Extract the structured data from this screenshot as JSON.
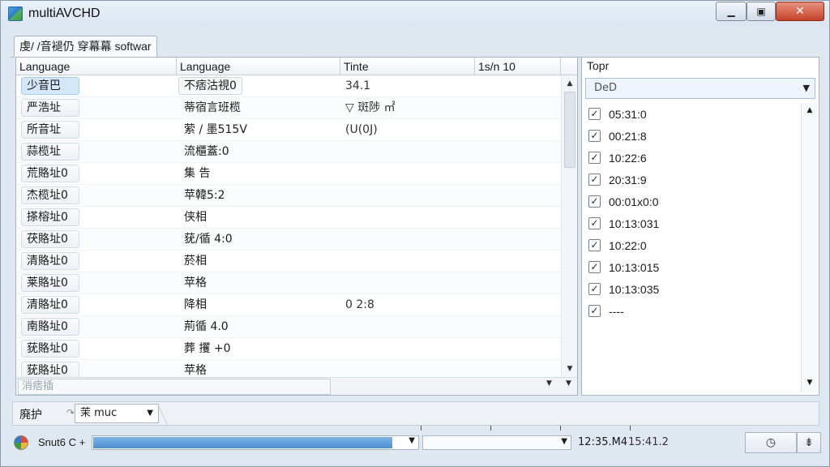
{
  "window": {
    "title": "multiAVCHD",
    "min_glyph": "▁",
    "max_glyph": "▣",
    "close_glyph": "✕"
  },
  "tab": {
    "label": "虔/ /音褪仍 穿幕幕 softwar"
  },
  "table": {
    "columns": [
      "Language",
      "Language",
      "Tinte",
      "1s/n 10"
    ],
    "rows": [
      {
        "c1": "少音巴",
        "c2": "不痞沽視0",
        "c3": "34.1",
        "c4": "",
        "selected": true
      },
      {
        "c1": "严浩址",
        "c2": "蒂宿言班榄",
        "c3": "▽ 斑陟 ㎡",
        "c4": ""
      },
      {
        "c1": "所音址",
        "c2": "萦 / 墨515V",
        "c3": "(U(0J)",
        "c4": ""
      },
      {
        "c1": "蒜榄址",
        "c2": "流櫃蓋:0",
        "c3": "",
        "c4": ""
      },
      {
        "c1": "荒賂址0",
        "c2": "集 告",
        "c3": "",
        "c4": ""
      },
      {
        "c1": "杰榄址0",
        "c2": "苹韓5:2",
        "c3": "",
        "c4": ""
      },
      {
        "c1": "搽榕址0",
        "c2": "侠相",
        "c3": "",
        "c4": ""
      },
      {
        "c1": "茯賂址0",
        "c2": "莸/循 4:0",
        "c3": "",
        "c4": ""
      },
      {
        "c1": "清賂址0",
        "c2": "菸相",
        "c3": "",
        "c4": ""
      },
      {
        "c1": "莱賂址0",
        "c2": "苹格",
        "c3": "",
        "c4": ""
      },
      {
        "c1": "清賂址0",
        "c2": "降相",
        "c3": "0 2:8",
        "c4": ""
      },
      {
        "c1": "南賂址0",
        "c2": "荊循 4.0",
        "c3": "",
        "c4": ""
      },
      {
        "c1": "莸賂址0",
        "c2": "葬 攫 +0",
        "c3": "",
        "c4": ""
      },
      {
        "c1": "莸賂址0",
        "c2": "苹格",
        "c3": "",
        "c4": ""
      }
    ],
    "footer_input": "消痞插",
    "scroll_up": "▲",
    "scroll_down": "▼"
  },
  "side": {
    "title": "Topr",
    "select_value": "DeD",
    "items": [
      {
        "label": "05:31:0",
        "checked": true
      },
      {
        "label": "00:21:8",
        "checked": true
      },
      {
        "label": "10:22:6",
        "checked": true
      },
      {
        "label": "20:31:9",
        "checked": true
      },
      {
        "label": "00:01x0:0",
        "checked": true
      },
      {
        "label": "10:13:031",
        "checked": true
      },
      {
        "label": "10:22:0",
        "checked": true
      },
      {
        "label": "10:13:015",
        "checked": true
      },
      {
        "label": "10:13:035",
        "checked": true
      },
      {
        "label": "----",
        "checked": true
      }
    ],
    "check_glyph": "✓"
  },
  "bottom": {
    "label": "廃护",
    "sep": "↷",
    "combo_value": "茉 muc",
    "caret": "▼"
  },
  "status": {
    "text": "Snut6 C +",
    "progress": 0.97,
    "time1": "12:35.M4",
    "time2": "15:41.2",
    "btn1": "◷",
    "btn2": "⇟",
    "colors": {
      "accent": "#4d8ed3",
      "close": "#c7432a"
    }
  }
}
